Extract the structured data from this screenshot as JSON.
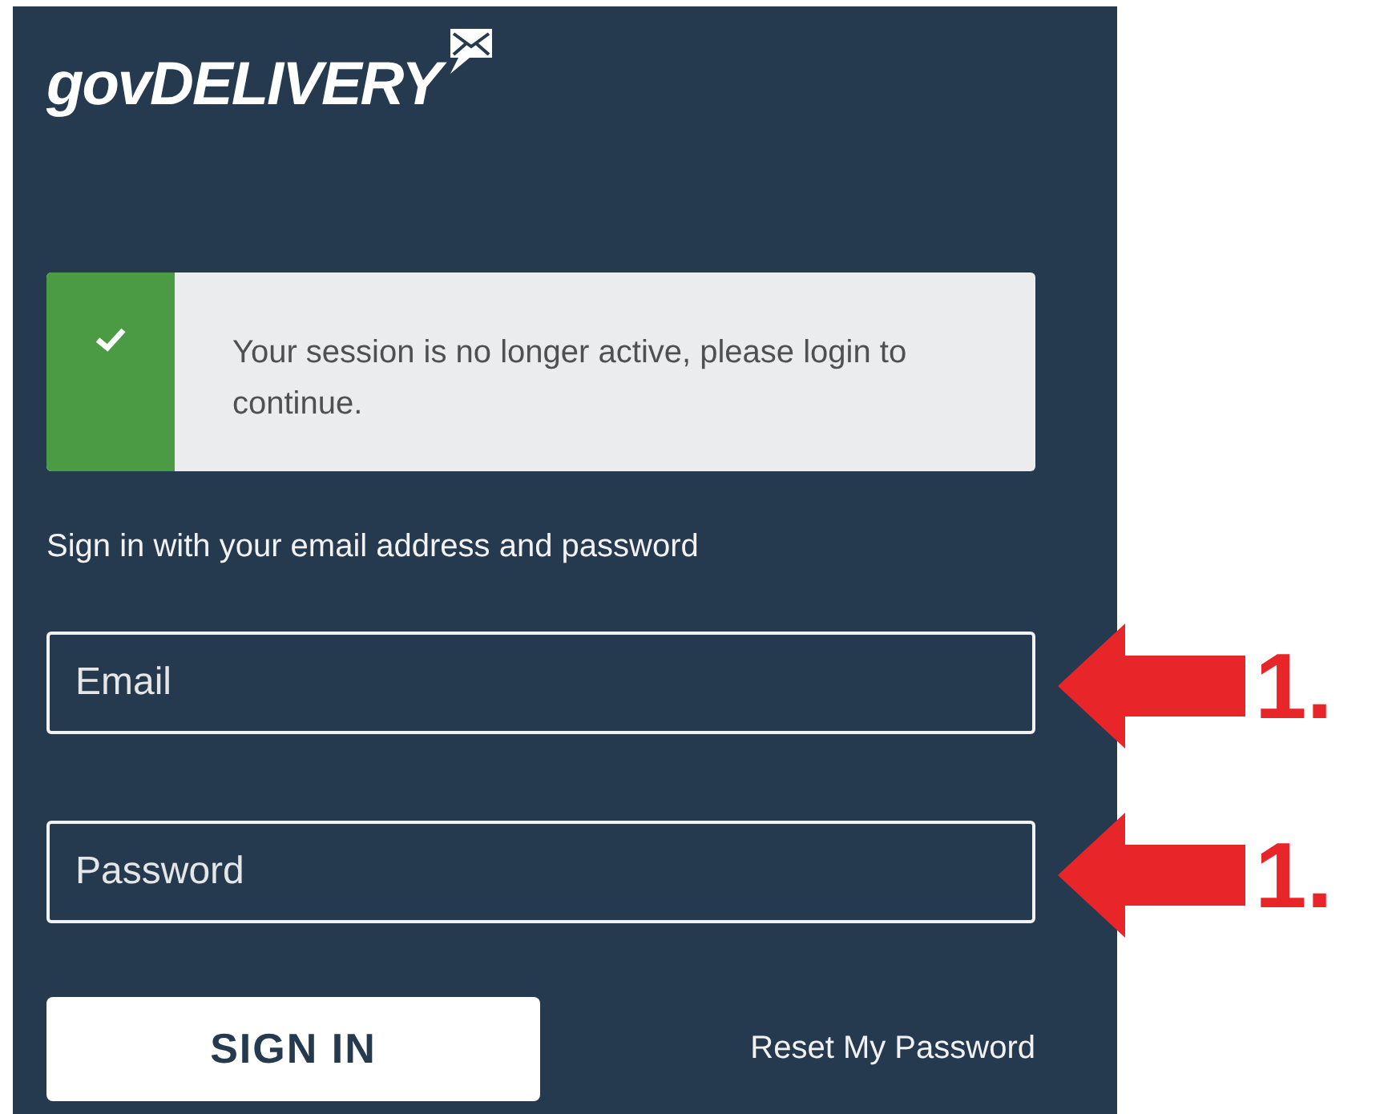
{
  "logo": {
    "text": "govDELIVERY"
  },
  "alert": {
    "kind": "success",
    "message": "Your session is no longer active, please login to continue."
  },
  "instructions": "Sign in with your email address and password",
  "fields": [
    {
      "placeholder": "Email",
      "annotation": "1."
    },
    {
      "placeholder": "Password",
      "annotation": "1."
    }
  ],
  "sign_in_button": "SIGN IN",
  "reset_link": "Reset My Password"
}
